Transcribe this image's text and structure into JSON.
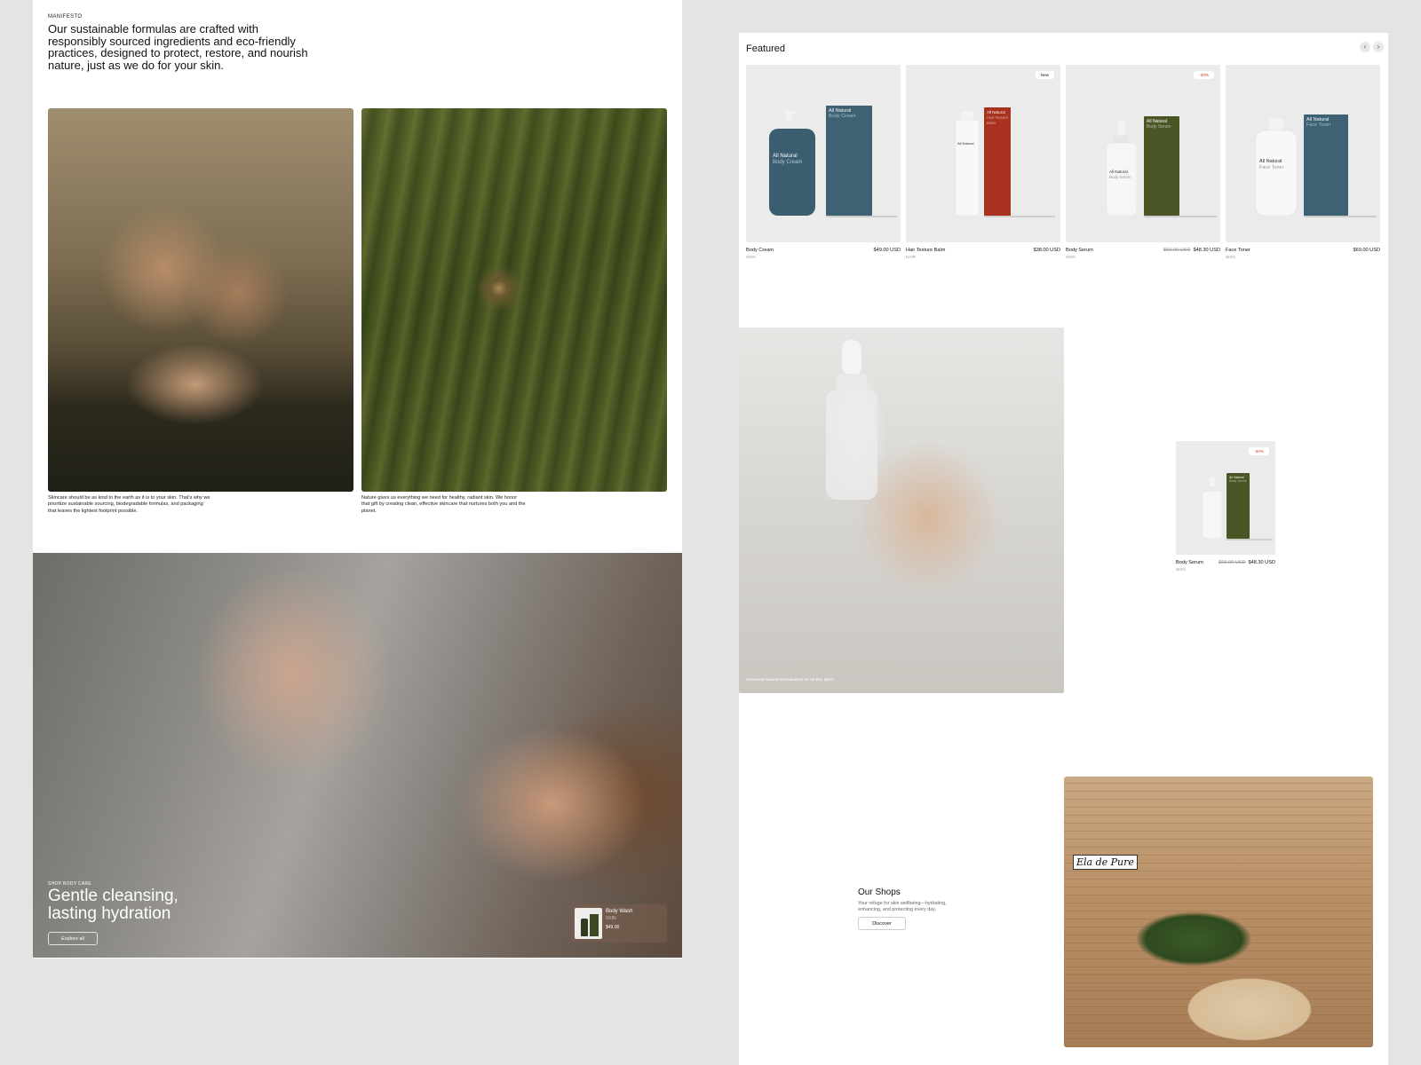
{
  "left": {
    "eyebrow": "MANIFESTO",
    "manifesto": "Our sustainable formulas are crafted with responsibly sourced ingredients and eco-friendly practices, designed to protect, restore, and nourish nature, just as we do for your skin.",
    "caption_1": "Skincare should be as kind to the earth as it is to your skin. That's why we prioritize sustainable sourcing, biodegradable formulas, and packaging that leaves the lightest footprint possible.",
    "caption_2": "Nature gives us everything we need for healthy, radiant skin. We honor that gift by creating clean, effective skincare that nurtures both you and the planet.",
    "hero": {
      "eyebrow": "SHOP BODY CARE",
      "title_line1": "Gentle cleansing,",
      "title_line2": "lasting hydration",
      "button": "Explore all",
      "mini_product": {
        "name": "Body Wash",
        "category": "SKIN",
        "price": "$49.00"
      }
    }
  },
  "right": {
    "featured_title": "Featured",
    "nav": {
      "prev": "‹",
      "next": "›"
    },
    "products": [
      {
        "name": "Body Cream",
        "category": "SKIN",
        "price": "$49.00 USD",
        "old_price": "",
        "badge": "",
        "brand": "All Natural",
        "label": "Body Cream",
        "color": "#3d6274"
      },
      {
        "name": "Hair Texture Balm",
        "category": "HAIR",
        "price": "$38.00 USD",
        "old_price": "",
        "badge": "New",
        "brand": "All Natural",
        "label": "Hair Texture Balm",
        "color": "#a8321f"
      },
      {
        "name": "Body Serum",
        "category": "SKIN",
        "price": "$48.30 USD",
        "old_price": "$69.00 USD",
        "badge": "-30%",
        "brand": "All Natural",
        "label": "Body Serum",
        "color": "#4a5626"
      },
      {
        "name": "Face Toner",
        "category": "SKIN",
        "price": "$69.00 USD",
        "old_price": "",
        "badge": "",
        "brand": "All Natural",
        "label": "Face Toner",
        "color": "#3d6274"
      }
    ],
    "lifestyle_caption": "Advanced Natural Formulations for all skin types",
    "single_product": {
      "name": "Body Serum",
      "category": "SKIN",
      "price": "$48.30 USD",
      "old_price": "$69.00 USD",
      "badge": "-30%",
      "brand": "All Natural",
      "label": "Body Serum"
    },
    "shops": {
      "title": "Our Shops",
      "text": "Your refuge for skin wellbeing—hydrating, enhancing, and protecting every day.",
      "button": "Discover",
      "sign": "Ela de Pure"
    }
  }
}
